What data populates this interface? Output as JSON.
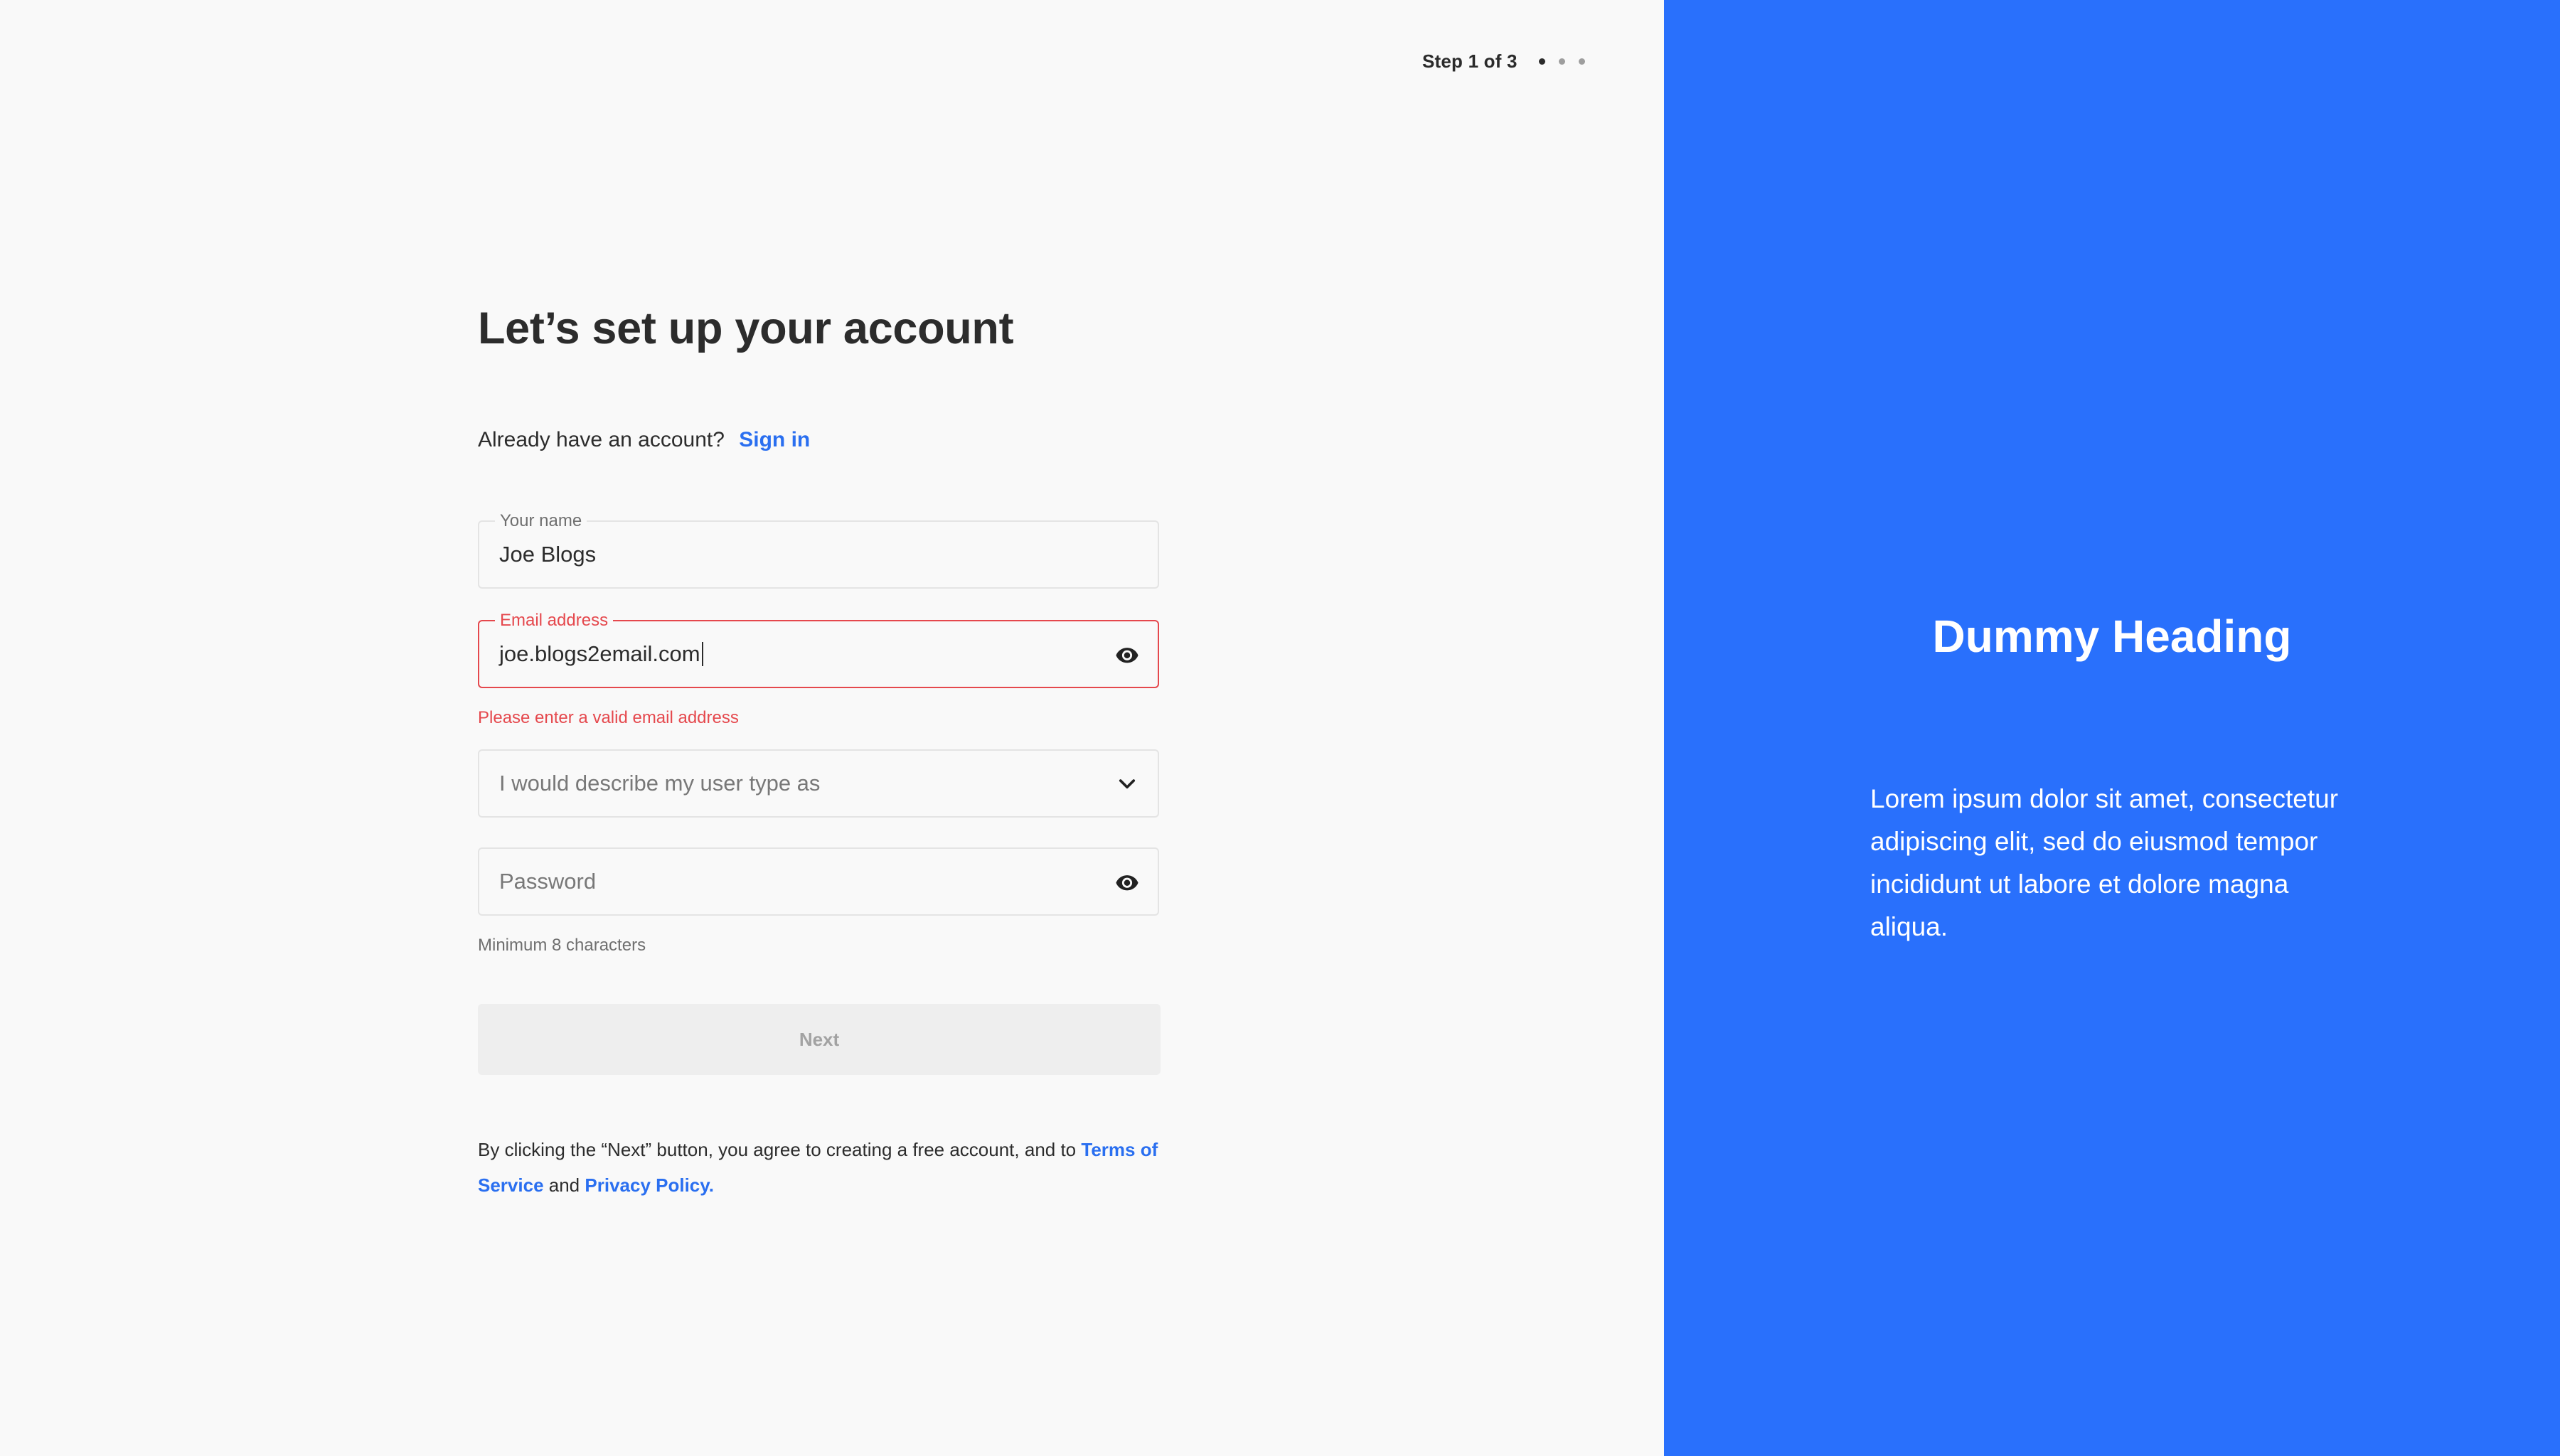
{
  "step_indicator": {
    "text": "Step 1 of 3",
    "current_step": 1,
    "total_steps": 3
  },
  "form": {
    "heading": "Let’s set up your account",
    "signin_prompt": "Already have an account?",
    "signin_link": "Sign in",
    "name_field": {
      "label": "Your name",
      "value": "Joe Blogs"
    },
    "email_field": {
      "label": "Email address",
      "value": "joe.blogs2email.com",
      "error": "Please enter a valid email address",
      "icon": "eye-icon"
    },
    "user_type_field": {
      "placeholder": "I would describe my user type as",
      "icon": "chevron-down-icon"
    },
    "password_field": {
      "placeholder": "Password",
      "hint": "Minimum 8 characters",
      "icon": "eye-icon"
    },
    "next_button": "Next",
    "terms": {
      "prefix": "By clicking the “Next” button, you agree to creating a free account, and to",
      "terms_link": "Terms of Service",
      "conjunction": "and",
      "privacy_link": "Privacy Policy."
    }
  },
  "promo": {
    "heading": "Dummy Heading",
    "body": "Lorem ipsum dolor sit amet, consectetur adipiscing elit, sed do eiusmod tempor incididunt ut labore et dolore magna aliqua."
  },
  "colors": {
    "accent": "#2970fc",
    "link": "#2a6ff0",
    "error": "#e5484d",
    "background": "#f9f9f9",
    "text": "#2c2c2c"
  }
}
